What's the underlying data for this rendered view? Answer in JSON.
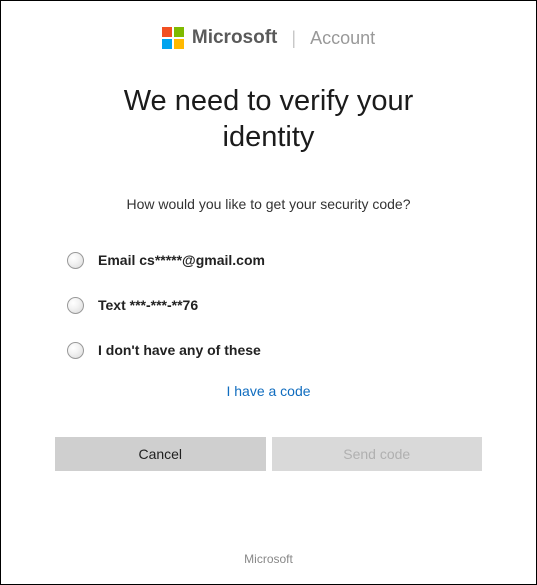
{
  "header": {
    "brand": "Microsoft",
    "section": "Account"
  },
  "title": "We need to verify your identity",
  "subtitle": "How would you like to get your security code?",
  "options": [
    {
      "label": "Email cs*****@gmail.com"
    },
    {
      "label": "Text ***-***-**76"
    },
    {
      "label": "I don't have any of these"
    }
  ],
  "have_code_link": "I have a code",
  "buttons": {
    "cancel": "Cancel",
    "send": "Send code"
  },
  "footer": "Microsoft"
}
